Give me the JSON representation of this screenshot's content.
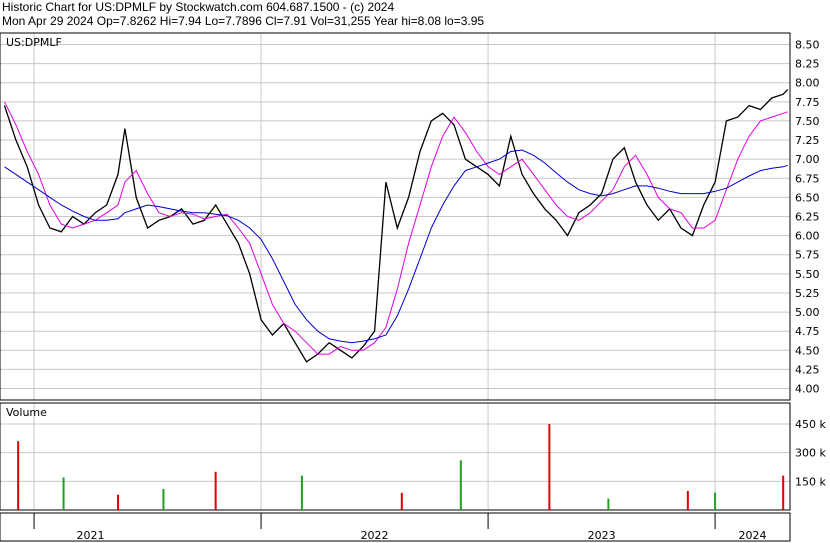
{
  "header": {
    "line1": "Historic Chart for US:DPMLF by Stockwatch.com 604.687.1500 - (c) 2024",
    "line2": "Mon Apr 29 2024  Op=7.8262  Hi=7.94  Lo=7.7896  Cl=7.91  Vol=31,255  Year hi=8.08  lo=3.95"
  },
  "chart_data": {
    "type": "line",
    "price_panel": {
      "label": "US:DPMLF",
      "ylim": [
        3.85,
        8.65
      ],
      "yticks": [
        "8.50",
        "8.25",
        "8.00",
        "7.75",
        "7.50",
        "7.25",
        "7.00",
        "6.75",
        "6.50",
        "6.25",
        "6.00",
        "5.75",
        "5.50",
        "5.25",
        "5.00",
        "4.75",
        "4.50",
        "4.25",
        "4.00"
      ],
      "grid": true,
      "x": [
        2020.87,
        2020.92,
        2020.97,
        2021.02,
        2021.07,
        2021.12,
        2021.17,
        2021.22,
        2021.27,
        2021.32,
        2021.37,
        2021.4,
        2021.45,
        2021.5,
        2021.55,
        2021.6,
        2021.65,
        2021.7,
        2021.75,
        2021.8,
        2021.85,
        2021.9,
        2021.95,
        2022.0,
        2022.05,
        2022.1,
        2022.15,
        2022.2,
        2022.25,
        2022.3,
        2022.35,
        2022.4,
        2022.45,
        2022.5,
        2022.55,
        2022.6,
        2022.65,
        2022.7,
        2022.75,
        2022.8,
        2022.85,
        2022.9,
        2022.95,
        2023.0,
        2023.05,
        2023.1,
        2023.15,
        2023.2,
        2023.25,
        2023.3,
        2023.35,
        2023.4,
        2023.45,
        2023.5,
        2023.55,
        2023.6,
        2023.65,
        2023.7,
        2023.75,
        2023.8,
        2023.85,
        2023.9,
        2023.95,
        2024.0,
        2024.05,
        2024.1,
        2024.15,
        2024.2,
        2024.25,
        2024.3,
        2024.32
      ],
      "close": [
        7.7,
        7.25,
        6.9,
        6.4,
        6.1,
        6.05,
        6.25,
        6.15,
        6.3,
        6.4,
        6.8,
        7.4,
        6.5,
        6.1,
        6.2,
        6.25,
        6.35,
        6.15,
        6.2,
        6.4,
        6.15,
        5.9,
        5.5,
        4.9,
        4.7,
        4.85,
        4.6,
        4.35,
        4.45,
        4.6,
        4.5,
        4.4,
        4.55,
        4.75,
        6.7,
        6.1,
        6.5,
        7.1,
        7.5,
        7.6,
        7.45,
        7.0,
        6.9,
        6.8,
        6.65,
        7.3,
        6.8,
        6.55,
        6.35,
        6.2,
        6.0,
        6.3,
        6.4,
        6.55,
        7.0,
        7.15,
        6.7,
        6.4,
        6.2,
        6.35,
        6.1,
        6.0,
        6.4,
        6.7,
        7.5,
        7.55,
        7.7,
        7.65,
        7.8,
        7.85,
        7.91
      ],
      "series": [
        {
          "values": [
            7.75,
            7.45,
            7.1,
            6.8,
            6.4,
            6.15,
            6.1,
            6.15,
            6.2,
            6.3,
            6.4,
            6.7,
            6.85,
            6.55,
            6.3,
            6.25,
            6.3,
            6.28,
            6.22,
            6.25,
            6.28,
            6.1,
            5.9,
            5.5,
            5.1,
            4.85,
            4.75,
            4.6,
            4.45,
            4.45,
            4.55,
            4.5,
            4.5,
            4.6,
            4.8,
            5.3,
            5.9,
            6.4,
            6.9,
            7.3,
            7.55,
            7.35,
            7.1,
            6.9,
            6.8,
            6.9,
            7.0,
            6.8,
            6.6,
            6.4,
            6.25,
            6.2,
            6.3,
            6.45,
            6.6,
            6.9,
            7.05,
            6.8,
            6.5,
            6.35,
            6.3,
            6.1,
            6.1,
            6.2,
            6.6,
            7.0,
            7.3,
            7.5,
            7.55,
            7.6,
            7.62
          ]
        },
        {
          "values": [
            6.9,
            6.8,
            6.7,
            6.6,
            6.5,
            6.4,
            6.32,
            6.25,
            6.2,
            6.2,
            6.22,
            6.3,
            6.35,
            6.4,
            6.38,
            6.35,
            6.32,
            6.3,
            6.3,
            6.28,
            6.26,
            6.2,
            6.1,
            5.95,
            5.7,
            5.4,
            5.1,
            4.9,
            4.75,
            4.65,
            4.62,
            4.6,
            4.62,
            4.65,
            4.7,
            4.95,
            5.3,
            5.7,
            6.1,
            6.4,
            6.65,
            6.85,
            6.9,
            6.95,
            7.0,
            7.1,
            7.12,
            7.05,
            6.95,
            6.82,
            6.7,
            6.6,
            6.55,
            6.52,
            6.55,
            6.6,
            6.65,
            6.65,
            6.62,
            6.58,
            6.55,
            6.55,
            6.55,
            6.58,
            6.62,
            6.7,
            6.78,
            6.85,
            6.88,
            6.9,
            6.92
          ]
        }
      ]
    },
    "volume_panel": {
      "label": "Volume",
      "ylim": [
        0,
        560
      ],
      "yticks": [
        "450 k",
        "300 k",
        "150 k"
      ],
      "x": [
        2020.93,
        2021.13,
        2021.37,
        2021.57,
        2021.8,
        2022.18,
        2022.62,
        2022.88,
        2023.27,
        2023.53,
        2023.88,
        2024.0,
        2024.3
      ],
      "values": [
        360,
        170,
        80,
        110,
        200,
        180,
        90,
        260,
        450,
        60,
        100,
        90,
        180
      ]
    },
    "xaxis": {
      "labels": [
        "2021",
        "2022",
        "2023",
        "2024"
      ],
      "dividers": [
        2021.0,
        2022.0,
        2023.0,
        2024.0
      ],
      "xlim": [
        2020.85,
        2024.33
      ]
    }
  }
}
